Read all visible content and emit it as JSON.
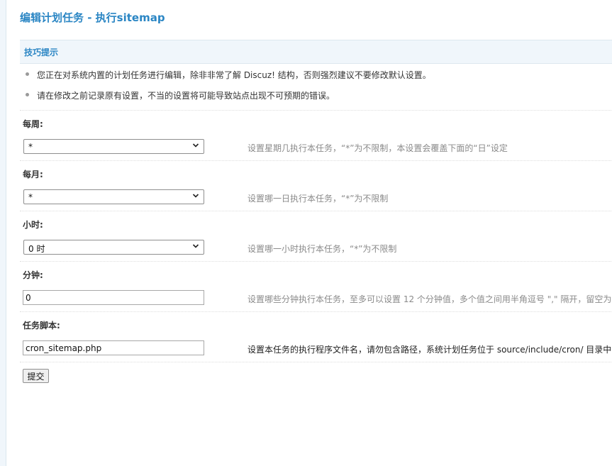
{
  "page": {
    "title": "编辑计划任务 - 执行sitemap"
  },
  "tips": {
    "header": "技巧提示",
    "items": [
      "您正在对系统内置的计划任务进行编辑，除非非常了解 Discuz! 结构，否则强烈建议不要修改默认设置。",
      "请在修改之前记录原有设置，不当的设置将可能导致站点出现不可预期的错误。"
    ]
  },
  "form": {
    "weekday": {
      "label": "每周:",
      "selected": "*",
      "hint": "设置星期几执行本任务，“*”为不限制，本设置会覆盖下面的“日”设定"
    },
    "day": {
      "label": "每月:",
      "selected": "*",
      "hint": "设置哪一日执行本任务，“*”为不限制"
    },
    "hour": {
      "label": "小时:",
      "selected": "0 时",
      "hint": "设置哪一小时执行本任务，“*”为不限制"
    },
    "minute": {
      "label": "分钟:",
      "value": "0",
      "hint": "设置哪些分钟执行本任务，至多可以设置 12 个分钟值，多个值之间用半角逗号 \",\" 隔开，留空为"
    },
    "script": {
      "label": "任务脚本:",
      "value": "cron_sitemap.php",
      "hint": "设置本任务的执行程序文件名，请勿包含路径，系统计划任务位于 source/include/cron/ 目录中"
    },
    "submit_label": "提交"
  },
  "icons": {
    "dropdown": "chevron-down-icon",
    "bullet": "bullet-icon"
  },
  "colors": {
    "accent": "#2b86c4",
    "tips_bg": "#f0f6fb",
    "hint": "#8a8a8a"
  }
}
